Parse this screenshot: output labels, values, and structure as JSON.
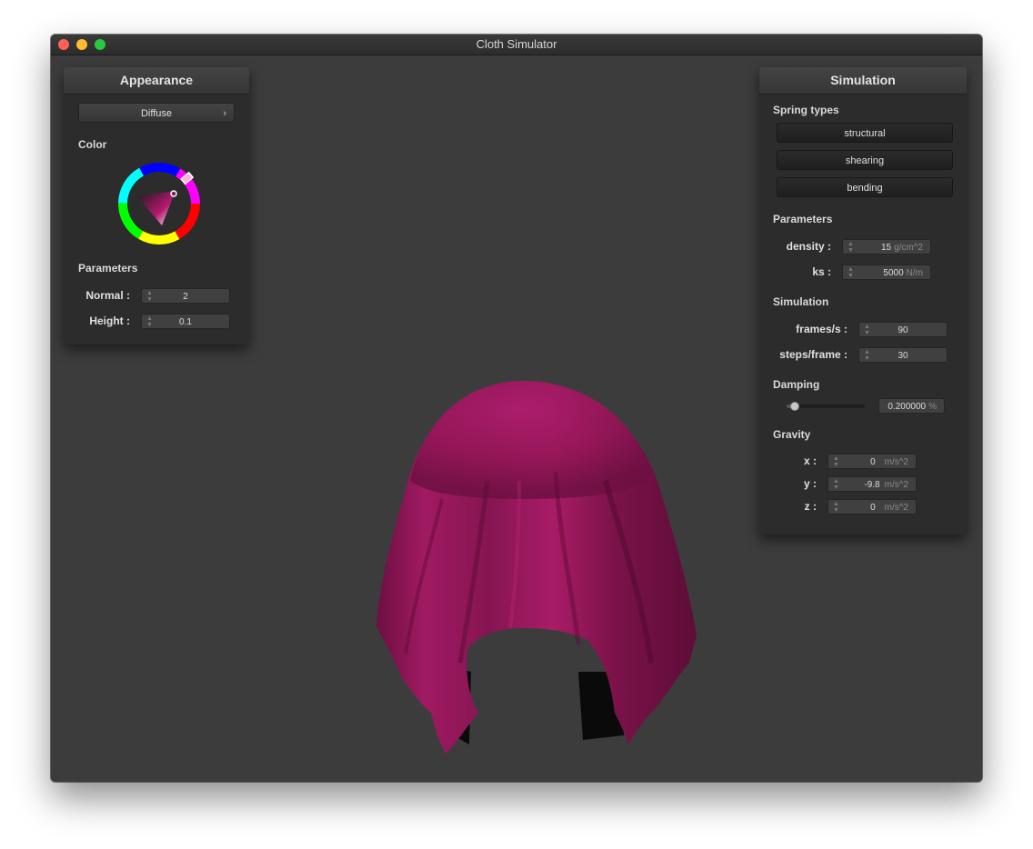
{
  "window": {
    "title": "Cloth Simulator"
  },
  "appearance": {
    "header": "Appearance",
    "shader": {
      "selected": "Diffuse"
    },
    "color_label": "Color",
    "color_value": "#b4186f",
    "parameters_label": "Parameters",
    "normal": {
      "label": "Normal :",
      "value": "2"
    },
    "height": {
      "label": "Height :",
      "value": "0.1"
    }
  },
  "simulation_panel": {
    "header": "Simulation",
    "spring_types": {
      "label": "Spring types",
      "buttons": [
        "structural",
        "shearing",
        "bending"
      ]
    },
    "parameters": {
      "label": "Parameters",
      "density": {
        "label": "density :",
        "value": "15",
        "unit": "g/cm^2"
      },
      "ks": {
        "label": "ks :",
        "value": "5000",
        "unit": "N/m"
      }
    },
    "simulation": {
      "label": "Simulation",
      "frames": {
        "label": "frames/s :",
        "value": "90"
      },
      "steps": {
        "label": "steps/frame :",
        "value": "30"
      }
    },
    "damping": {
      "label": "Damping",
      "value": "0.200000",
      "unit": "%",
      "slider_fraction": 0.2
    },
    "gravity": {
      "label": "Gravity",
      "x": {
        "label": "x :",
        "value": "0",
        "unit": "m/s^2"
      },
      "y": {
        "label": "y :",
        "value": "-9.8",
        "unit": "m/s^2"
      },
      "z": {
        "label": "z :",
        "value": "0",
        "unit": "m/s^2"
      }
    }
  },
  "colors": {
    "cloth": "#a0185f",
    "background": "#3c3c3c",
    "panel": "#2c2c2c"
  }
}
